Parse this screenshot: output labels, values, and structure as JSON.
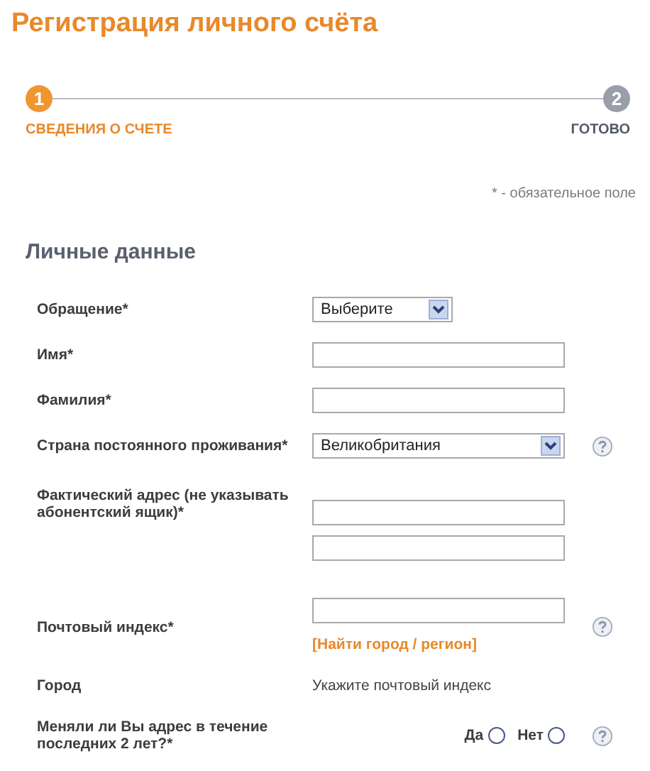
{
  "title": "Регистрация личного счёта",
  "steps": [
    {
      "number": "1",
      "label": "СВЕДЕНИЯ О СЧЕТЕ",
      "selected": true
    },
    {
      "number": "2",
      "label": "ГОТОВО",
      "selected": false
    }
  ],
  "required_note": "* - обязательное поле",
  "section_title": "Личные данные",
  "fields": [
    {
      "kind": "select",
      "label": "Обращение*",
      "value": "Выберите",
      "wide": false,
      "help": false
    },
    {
      "kind": "text",
      "label": "Имя*",
      "help": false
    },
    {
      "kind": "text",
      "label": "Фамилия*",
      "help": false
    },
    {
      "kind": "select",
      "label": "Страна постоянного проживания*",
      "value": "Великобритания",
      "wide": true,
      "help": true
    },
    {
      "kind": "address",
      "label": "Фактический адрес (не указывать абонентский ящик)*",
      "help": false
    },
    {
      "kind": "text",
      "label": "Почтовый индекс*",
      "link": "[Найти город / регион]",
      "help": true
    },
    {
      "kind": "info",
      "label": "Город",
      "value": "Укажите почтовый индекс",
      "help": false
    },
    {
      "kind": "radio",
      "label": "Меняли ли Вы адрес в течение последних 2 лет?*",
      "options": [
        {
          "label": "Да",
          "selected": false
        },
        {
          "label": "Нет",
          "selected": false
        }
      ],
      "help": true
    }
  ]
}
